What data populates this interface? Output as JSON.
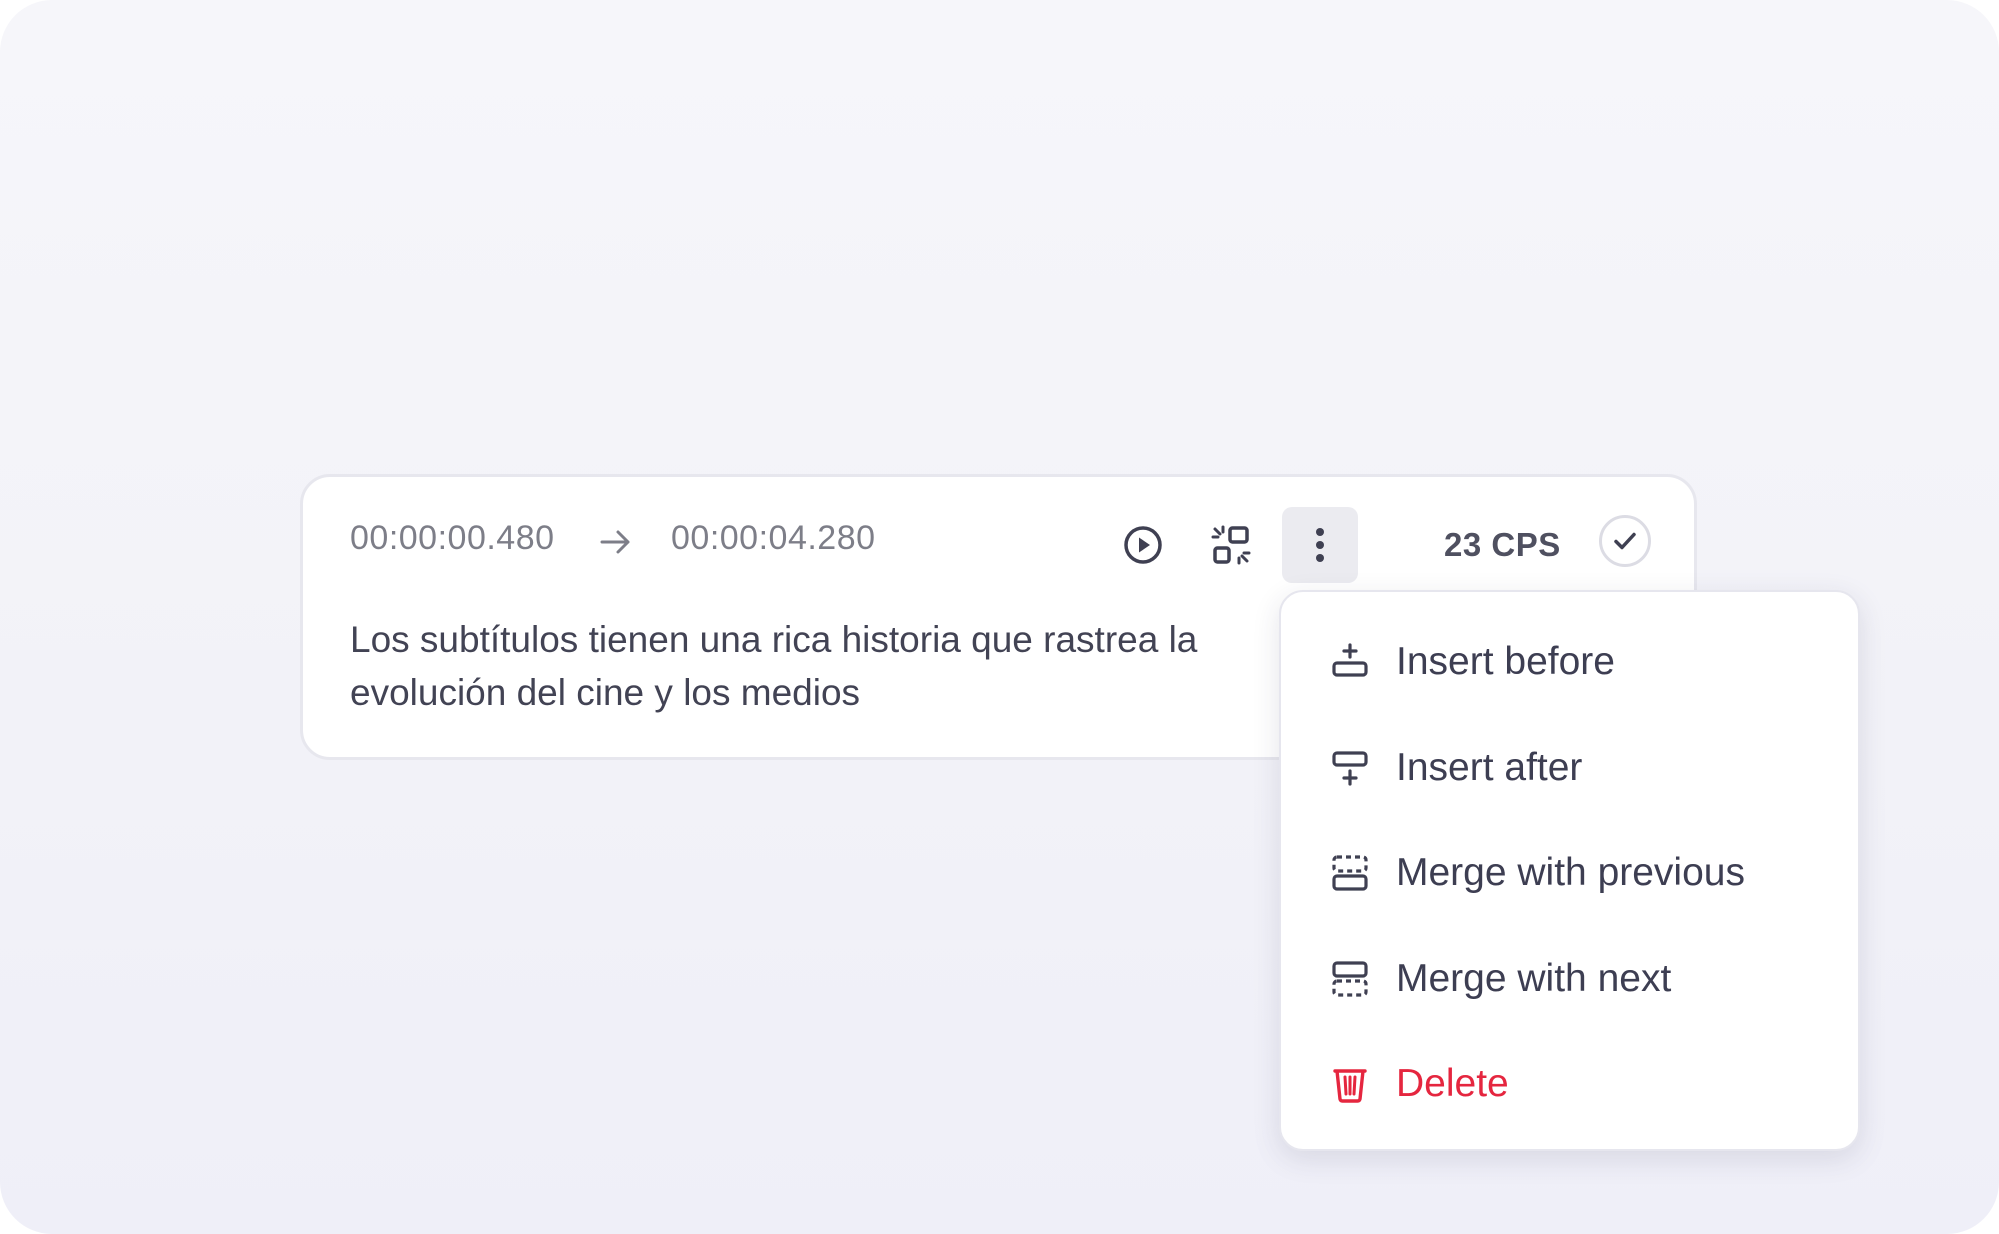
{
  "segment": {
    "start_time": "00:00:00.480",
    "end_time": "00:00:04.280",
    "cps": "23 CPS",
    "text": "Los subtítulos tienen una rica historia que rastrea la evolución del cine y los medios"
  },
  "menu": {
    "items": [
      {
        "label": "Insert before",
        "icon": "insert-before-icon"
      },
      {
        "label": "Insert after",
        "icon": "insert-after-icon"
      },
      {
        "label": "Merge with previous",
        "icon": "merge-previous-icon"
      },
      {
        "label": "Merge with next",
        "icon": "merge-next-icon"
      },
      {
        "label": "Delete",
        "icon": "trash-icon"
      }
    ]
  },
  "colors": {
    "text": "#424354",
    "muted": "#7d7e88",
    "danger": "#e5263f",
    "active_button_bg": "#ebebf0"
  }
}
